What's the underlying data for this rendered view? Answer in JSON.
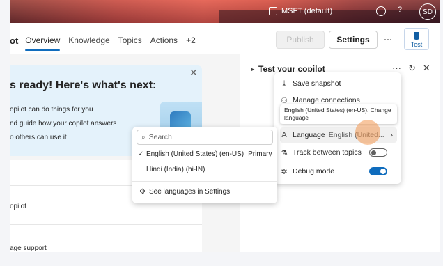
{
  "header": {
    "environment": "MSFT (default)",
    "avatar_initials": "SD"
  },
  "nav": {
    "breadcrumb_tail": "ot",
    "tabs": [
      {
        "label": "Overview",
        "active": true
      },
      {
        "label": "Knowledge"
      },
      {
        "label": "Topics"
      },
      {
        "label": "Actions"
      },
      {
        "label": "+2"
      }
    ],
    "publish_label": "Publish",
    "settings_label": "Settings",
    "more_label": "···",
    "test_label": "Test"
  },
  "promo": {
    "heading": "s ready! Here's what's next:",
    "lines": [
      "opilot can do things for you",
      "nd guide how your copilot answers",
      "o others can use it"
    ]
  },
  "card": {
    "rows": [
      "opilot",
      "age support"
    ]
  },
  "test_panel": {
    "title": "Test your copilot"
  },
  "menu": {
    "save_snapshot": "Save snapshot",
    "manage_connections": "Manage connections",
    "tooltip": "English (United States) (en-US). Change language",
    "language_label": "Language",
    "language_value": "English (United...",
    "track_topics": "Track between topics",
    "debug_mode": "Debug mode",
    "track_on": false,
    "debug_on": true
  },
  "languages": {
    "search_placeholder": "Search",
    "items": [
      {
        "label": "English (United States) (en-US)",
        "tag": "Primary",
        "selected": true
      },
      {
        "label": "Hindi (India) (hi-IN)",
        "tag": "",
        "selected": false
      }
    ],
    "see_settings": "See languages in Settings"
  },
  "colors": {
    "accent": "#0f6cbd",
    "highlight_pulse": "#f39850"
  }
}
